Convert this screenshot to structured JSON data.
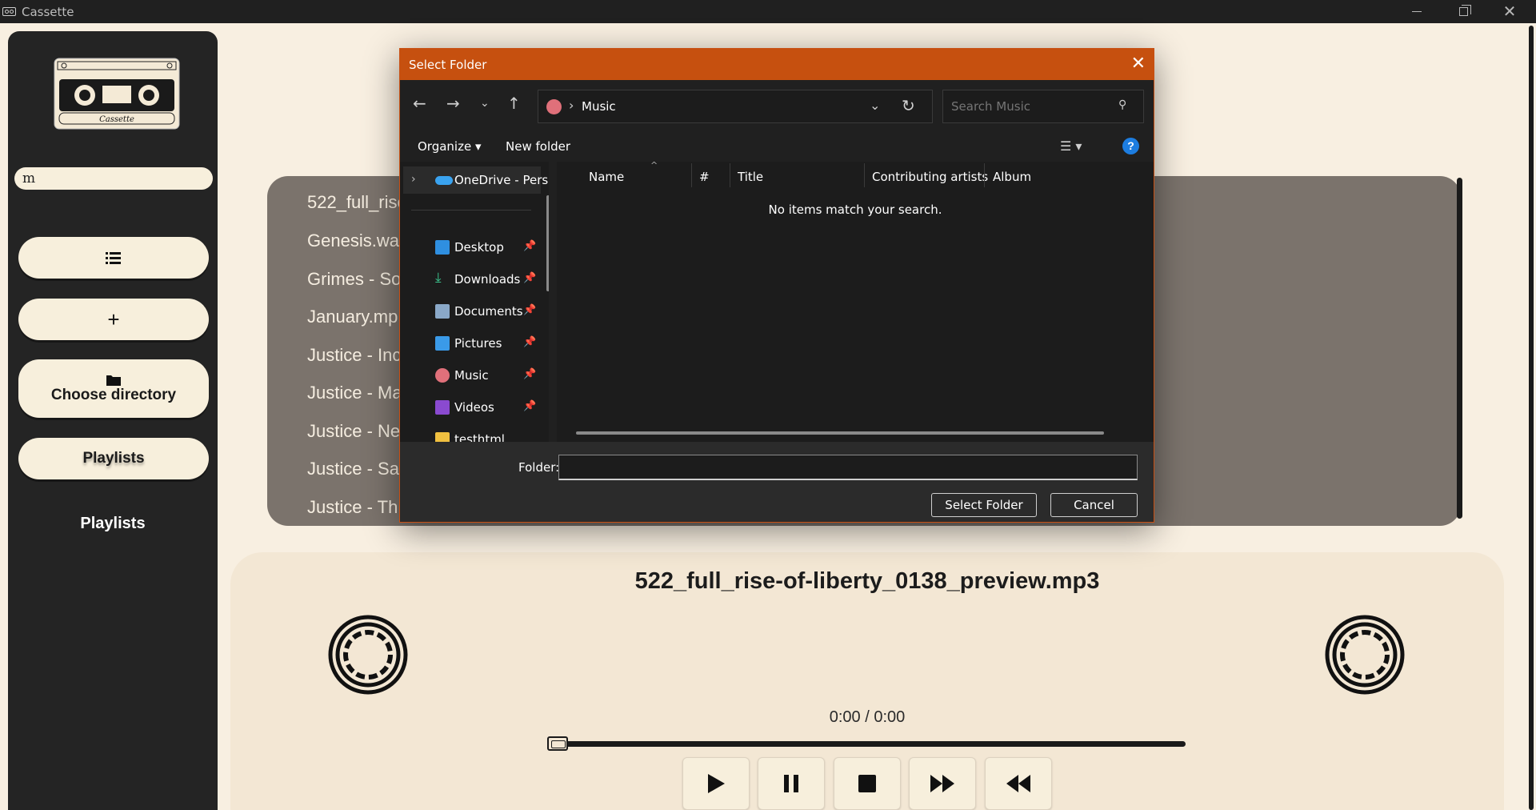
{
  "window": {
    "title": "Cassette"
  },
  "sidebar": {
    "search_value": "m",
    "choose_directory_label": "Choose directory",
    "playlists_button_label": "Playlists",
    "playlists_heading": "Playlists"
  },
  "songs": [
    "522_full_rise",
    "Genesis.wa",
    "Grimes - So",
    "January.mp",
    "Justice - Inc",
    "Justice - Ma",
    "Justice - Ne",
    "Justice - Sa",
    "Justice - Th"
  ],
  "player": {
    "now_playing": "522_full_rise-of-liberty_0138_preview.mp3",
    "time": "0:00 / 0:00",
    "progress": 0
  },
  "dialog": {
    "title": "Select Folder",
    "breadcrumb": "Music",
    "search_placeholder": "Search Music",
    "organize_label": "Organize",
    "new_folder_label": "New folder",
    "nav": {
      "onedrive": "OneDrive - Perso",
      "items": [
        "Desktop",
        "Downloads",
        "Documents",
        "Pictures",
        "Music",
        "Videos",
        "testhtml"
      ]
    },
    "columns": [
      "Name",
      "#",
      "Title",
      "Contributing artists",
      "Album"
    ],
    "empty_message": "No items match your search.",
    "folder_label": "Folder:",
    "folder_value": "",
    "select_button": "Select Folder",
    "cancel_button": "Cancel"
  },
  "colors": {
    "accent": "#c6500f",
    "background": "#f8efe1",
    "sidebar": "#242424",
    "list_bg": "#7b736c"
  }
}
